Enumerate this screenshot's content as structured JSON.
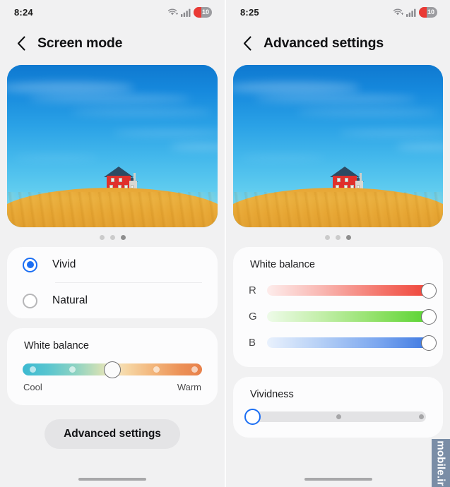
{
  "screens": [
    {
      "id": "screen-mode",
      "status_bar": {
        "time": "8:24",
        "wifi_icon": "wifi-icon",
        "signal_icon": "signal-bars-icon",
        "battery_level": "10"
      },
      "header": {
        "back_icon": "chevron-left-icon",
        "title": "Screen mode"
      },
      "preview": {
        "alt": "red-house-wheat-field-wallpaper",
        "dots": [
          {
            "active": false
          },
          {
            "active": false
          },
          {
            "active": true
          }
        ]
      },
      "mode_options": [
        {
          "label": "Vivid",
          "selected": true
        },
        {
          "label": "Natural",
          "selected": false
        }
      ],
      "white_balance": {
        "title": "White balance",
        "cool_label": "Cool",
        "warm_label": "Warm",
        "value_percent": 50,
        "tick_percents": [
          3,
          26,
          74,
          97
        ]
      },
      "advanced_button": "Advanced settings"
    },
    {
      "id": "advanced-settings",
      "status_bar": {
        "time": "8:25",
        "wifi_icon": "wifi-icon",
        "signal_icon": "signal-bars-icon",
        "battery_level": "10"
      },
      "header": {
        "back_icon": "chevron-left-icon",
        "title": "Advanced settings"
      },
      "preview": {
        "alt": "red-house-wheat-field-wallpaper",
        "dots": [
          {
            "active": false
          },
          {
            "active": false
          },
          {
            "active": true
          }
        ]
      },
      "white_balance": {
        "title": "White balance",
        "channels": [
          {
            "label": "R",
            "value_percent": 100,
            "color": "#ef4136"
          },
          {
            "label": "G",
            "value_percent": 100,
            "color": "#56d32f"
          },
          {
            "label": "B",
            "value_percent": 100,
            "color": "#3b76e0"
          }
        ]
      },
      "vividness": {
        "title": "Vividness",
        "value_percent": 0,
        "tick_percents": [
          50,
          97
        ]
      }
    }
  ],
  "watermark": {
    "text": "mobile.ir"
  },
  "colors": {
    "accent": "#1b6ef3",
    "background": "#f1f1f2",
    "card": "#fcfcfd",
    "battery_red": "#ea3a35"
  }
}
